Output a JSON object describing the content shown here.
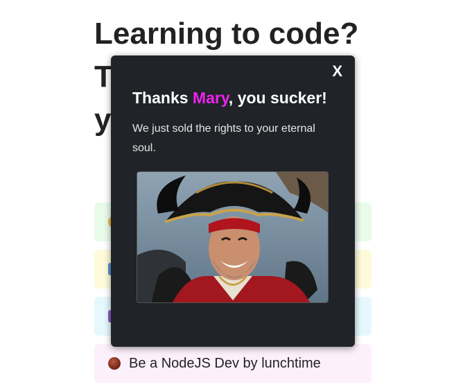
{
  "page": {
    "headline": "Learning to code? The secret is in your own hands!"
  },
  "cards": [
    {
      "label": "",
      "bg": "#e9fbe9",
      "icon_color": "#f0b840"
    },
    {
      "label": "",
      "bg": "#fdfbd9",
      "icon_color": "#5a8fd8"
    },
    {
      "label": "",
      "bg": "#e6f8fd",
      "icon_color": "#8a5cc8"
    },
    {
      "label": "Be a NodeJS Dev by lunchtime",
      "bg": "#fdf0fd",
      "icon_color": "#8a3a2a"
    }
  ],
  "modal": {
    "close_label": "X",
    "title_prefix": "Thanks ",
    "title_name": "Mary",
    "title_suffix": ", you sucker!",
    "message": "We just sold the rights to your eternal soul.",
    "name_color": "#ee22ee",
    "image_subject": "pirate-captain-laughing"
  }
}
